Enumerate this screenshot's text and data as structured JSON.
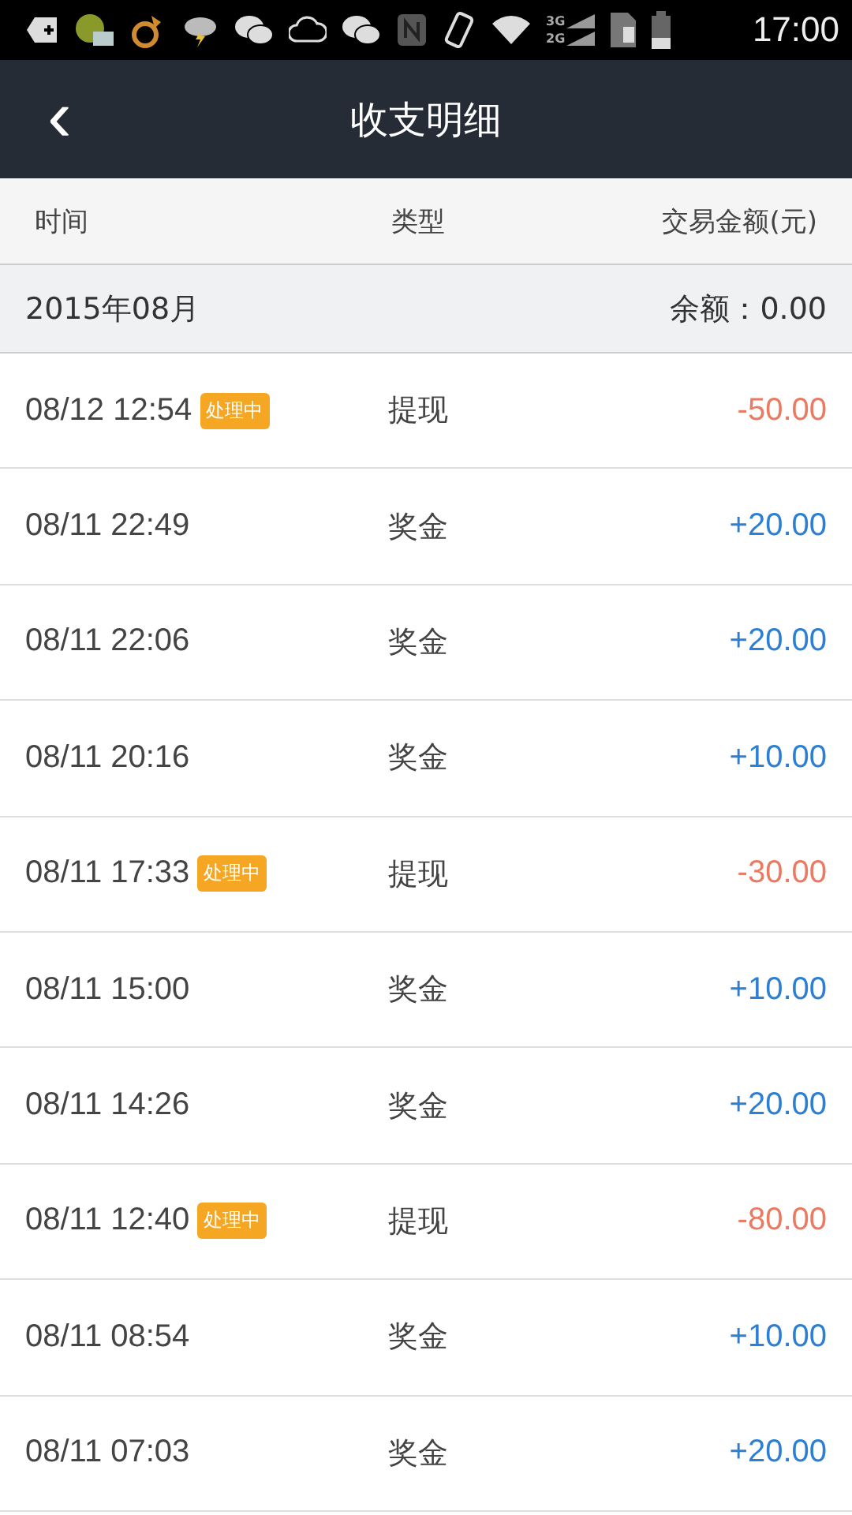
{
  "status_bar": {
    "network_labels": [
      "3G",
      "2G"
    ],
    "time": "17:00"
  },
  "header": {
    "back": "‹",
    "title": "收支明细"
  },
  "columns": [
    "时间",
    "类型",
    "交易金额(元)"
  ],
  "month": {
    "label": "2015年08月",
    "balance": "余额：0.00"
  },
  "rows": [
    {
      "time": "08/12 12:54",
      "badge": "处理中",
      "type": "提现",
      "amount": "-50.00",
      "kind": "withdrawal"
    },
    {
      "time": "08/11 22:49",
      "type": "奖金",
      "amount": "+20.00",
      "kind": "bonus"
    },
    {
      "time": "08/11 22:06",
      "type": "奖金",
      "amount": "+20.00",
      "kind": "bonus"
    },
    {
      "time": "08/11 20:16",
      "type": "奖金",
      "amount": "+10.00",
      "kind": "bonus"
    },
    {
      "time": "08/11 17:33",
      "badge": "处理中",
      "type": "提现",
      "amount": "-30.00",
      "kind": "withdrawal"
    },
    {
      "time": "08/11 15:00",
      "type": "奖金",
      "amount": "+10.00",
      "kind": "bonus"
    },
    {
      "time": "08/11 14:26",
      "type": "奖金",
      "amount": "+20.00",
      "kind": "bonus"
    },
    {
      "time": "08/11 12:40",
      "badge": "处理中",
      "type": "提现",
      "amount": "-80.00",
      "kind": "withdrawal"
    },
    {
      "time": "08/11 08:54",
      "type": "奖金",
      "amount": "+10.00",
      "kind": "bonus"
    },
    {
      "time": "08/11 07:03",
      "type": "奖金",
      "amount": "+20.00",
      "kind": "bonus"
    }
  ]
}
